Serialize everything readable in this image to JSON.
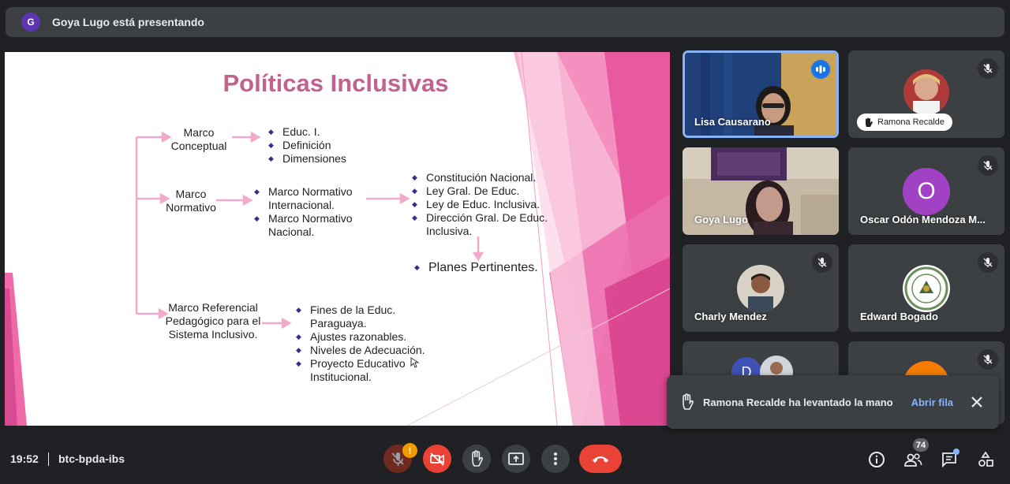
{
  "banner": {
    "presenter_initial": "G",
    "text": "Goya Lugo está presentando"
  },
  "slide": {
    "title": "Políticas Inclusivas",
    "marco_conceptual": [
      "Marco",
      "Conceptual"
    ],
    "conceptual_items": [
      "Educ. I.",
      "Definición",
      "Dimensiones"
    ],
    "marco_normativo": [
      "Marco",
      "Normativo"
    ],
    "normativo_items": [
      "Marco Normativo Internacional.",
      "Marco Normativo Nacional."
    ],
    "normativo_items_lines": [
      [
        "Marco Normativo",
        "Internacional."
      ],
      [
        "Marco Normativo",
        "Nacional."
      ]
    ],
    "legal_items_lines": [
      [
        "Constitución Nacional."
      ],
      [
        "Ley Gral. De Educ."
      ],
      [
        "Ley de Educ. Inclusiva."
      ],
      [
        "Dirección Gral. De Educ.",
        "Inclusiva."
      ]
    ],
    "planes": "Planes Pertinentes.",
    "marco_referencial": [
      "Marco Referencial",
      "Pedagógico para el",
      "Sistema Inclusivo."
    ],
    "referencial_items_lines": [
      [
        "Fines de la Educ.",
        "Paraguaya."
      ],
      [
        "Ajustes razonables."
      ],
      [
        "Niveles de Adecuación."
      ],
      [
        "Proyecto Educativo",
        "Institucional."
      ]
    ]
  },
  "participants": {
    "lisa": "Lisa Causarano",
    "ramona": "Ramona Recalde",
    "goya": "Goya Lugo",
    "oscar": "Oscar Odón Mendoza M...",
    "oscar_initial": "O",
    "charly": "Charly Mendez",
    "edward": "Edward Bogado",
    "tile7_initial": "D"
  },
  "toast": {
    "message": "Ramona Recalde ha levantado la mano",
    "action": "Abrir fila"
  },
  "bottombar": {
    "time": "19:52",
    "meeting_code": "btc-bpda-ibs",
    "mic_warning": "!",
    "participants_count": "74"
  },
  "colors": {
    "accent": "#8ab4f8",
    "danger": "#ea4335",
    "slide_title": "#c2628f",
    "bullet": "#3f2a8c"
  }
}
